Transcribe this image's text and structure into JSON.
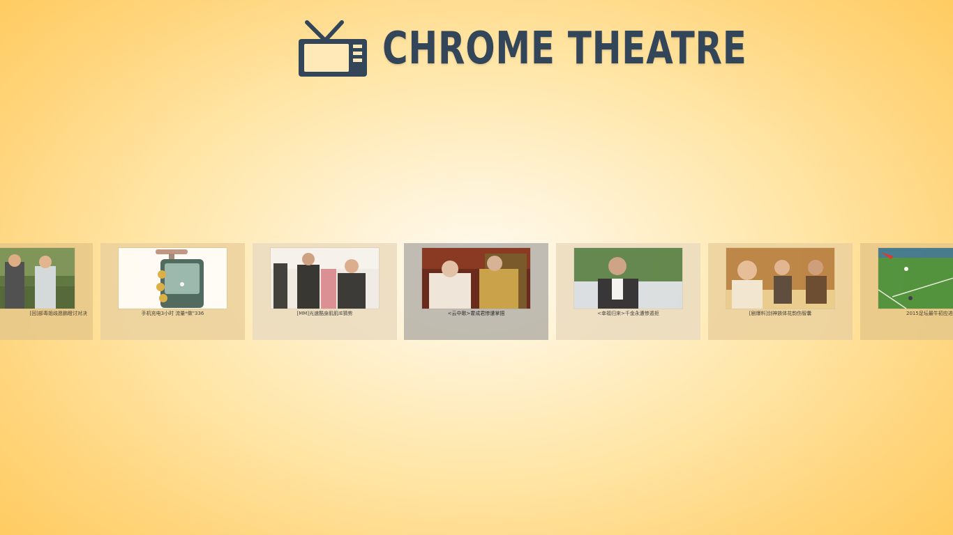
{
  "app": {
    "title": "CHROME THEATRE",
    "logo_icon": "tv-icon"
  },
  "colors": {
    "brand": "#334559",
    "selected_tile": "#a8a49a"
  },
  "carousel": {
    "selected_index": 3,
    "items": [
      {
        "caption": "[回]部毒姐歧愿鹏瞪讨对决",
        "tint": "#e8c98a"
      },
      {
        "caption": "手机充电3小时 流量*做\"336",
        "tint": "#ecd29e"
      },
      {
        "caption": "[MM]光速酷身肌肌IE猜势",
        "tint": "#ecdcc0"
      },
      {
        "caption": "<云中歌>霍成君惨遭掌掴",
        "tint": "#b0aa9c"
      },
      {
        "caption": "<幸福归来>千金永遭惨遁拒",
        "tint": "#ecdcc0"
      },
      {
        "caption": "[剧爆料]剑神族体花韵伤智囊",
        "tint": "#ecd29e"
      },
      {
        "caption": "2015足坛最牛初应进",
        "tint": "#e8c98a"
      }
    ]
  }
}
